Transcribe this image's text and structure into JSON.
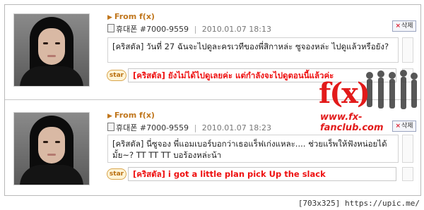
{
  "posts": [
    {
      "from": "From f(x)",
      "phone_label": "휴대폰",
      "number": "#7000-9559",
      "date": "2010.01.07 18:13",
      "delete_label": "삭제",
      "message": "[คริสตัล] วันที่ 27 ฉันจะไปดูละครเวทีของพี่สิกาหล่ะ ซูจองหล่ะ ไปดูแล้วหรือยัง?",
      "star_label": "star",
      "reply": "[คริสตัล] ยังไม่ได้ไปดูเลยค่ะ แต่กำลังจะไปดูตอนนี้แล้วค่ะ"
    },
    {
      "from": "From f(x)",
      "phone_label": "휴대폰",
      "number": "#7000-9559",
      "date": "2010.01.07 18:23",
      "delete_label": "삭제",
      "message": "[คริสตัล] นี่ซูจอง พี่แอมเบอร์บอกว่าเธอแร็ฟเก่งแหละ.... ช่วยแร็พให้ฟังหน่อยได้มั้ย~? TT TT TT บอร้องหล่ะน้า",
      "star_label": "star",
      "reply": "[คริสตัล] i got a little plan pick Up the slack"
    }
  ],
  "watermark": {
    "logo_text": "f(x)",
    "site": "www.fx-fanclub.com"
  },
  "credit": "[703x325] https://upic.me/",
  "colors": {
    "from": "#c0761c",
    "reply": "#ee1111",
    "logo": "#e21a1a"
  }
}
